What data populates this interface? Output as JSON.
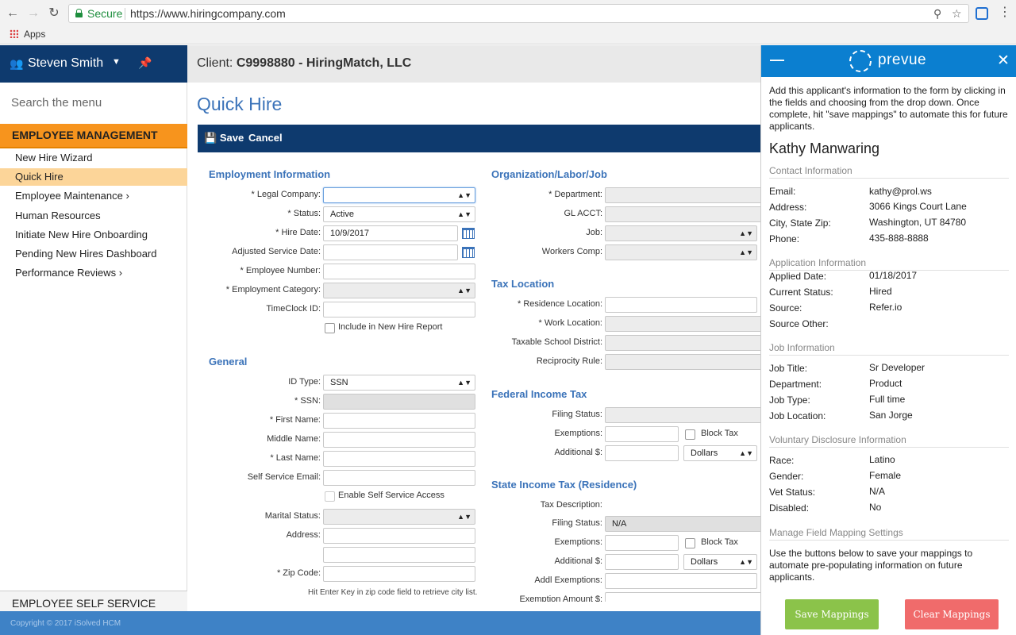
{
  "browser": {
    "secure_label": "Secure",
    "url": "https://www.hiringcompany.com",
    "apps_label": "Apps"
  },
  "sidebar": {
    "user_name": "Steven Smith",
    "search_placeholder": "Search the menu",
    "section": "EMPLOYEE MANAGEMENT",
    "items": [
      {
        "label": "New Hire Wizard"
      },
      {
        "label": "Quick Hire"
      },
      {
        "label": "Employee Maintenance  ›"
      },
      {
        "label": "Human Resources"
      },
      {
        "label": "Initiate New Hire Onboarding"
      },
      {
        "label": "Pending New Hires Dashboard"
      },
      {
        "label": "Performance Reviews  ›"
      }
    ],
    "self_service": "EMPLOYEE SELF SERVICE",
    "copyright": "Copyright © 2017 iSolved HCM"
  },
  "header": {
    "client_prefix": "Client:",
    "client_name": "C9998880 - HiringMatch, LLC"
  },
  "page": {
    "title": "Quick Hire",
    "save": "Save",
    "cancel": "Cancel"
  },
  "employment": {
    "title": "Employment Information",
    "legal_company": "* Legal Company:",
    "status": "* Status:",
    "status_value": "Active",
    "hire_date": "* Hire Date:",
    "hire_date_value": "10/9/2017",
    "adjusted_service_date": "Adjusted Service Date:",
    "employee_number": "* Employee Number:",
    "employment_category": "* Employment Category:",
    "timeclock_id": "TimeClock ID:",
    "include_report": "Include in New Hire Report"
  },
  "general": {
    "title": "General",
    "id_type": "ID Type:",
    "id_type_value": "SSN",
    "ssn": "* SSN:",
    "first_name": "* First Name:",
    "middle_name": "Middle Name:",
    "last_name": "* Last Name:",
    "self_service_email": "Self Service Email:",
    "enable_self_service": "Enable Self Service Access",
    "marital_status": "Marital Status:",
    "address": "Address:",
    "zip_code": "* Zip Code:",
    "zip_hint": "Hit Enter Key in zip code field to retrieve city list."
  },
  "org": {
    "title": "Organization/Labor/Job",
    "department": "* Department:",
    "gl_acct": "GL ACCT:",
    "job": "Job:",
    "workers_comp": "Workers Comp:"
  },
  "tax_location": {
    "title": "Tax Location",
    "residence_location": "* Residence Location:",
    "work_location": "* Work Location:",
    "taxable_school_district": "Taxable School District:",
    "reciprocity_rule": "Reciprocity Rule:"
  },
  "federal": {
    "title": "Federal Income Tax",
    "filing_status": "Filing Status:",
    "exemptions": "Exemptions:",
    "block_tax": "Block Tax",
    "additional": "Additional $:",
    "dollars": "Dollars"
  },
  "state": {
    "title": "State Income Tax (Residence)",
    "tax_description": "Tax Description:",
    "filing_status": "Filing Status:",
    "filing_status_value": "N/A",
    "exemptions": "Exemptions:",
    "block_tax": "Block Tax",
    "additional": "Additional $:",
    "dollars": "Dollars",
    "addl_exemptions": "Addl Exemptions:",
    "exemption_amount": "Exemption Amount $:"
  },
  "prevue": {
    "brand": "prevue",
    "intro": "Add this applicant's information to the form by clicking in the fields and choosing from the drop down. Once complete, hit \"save mappings\" to automate this for future applicants.",
    "name": "Kathy Manwaring",
    "contact_title": "Contact Information",
    "contact": [
      {
        "k": "Email:",
        "v": "kathy@prol.ws"
      },
      {
        "k": "Address:",
        "v": "3066 Kings Court Lane"
      },
      {
        "k": "City, State Zip:",
        "v": "Washington, UT 84780"
      },
      {
        "k": "Phone:",
        "v": "435-888-8888"
      }
    ],
    "application_title": "Application Information",
    "application": [
      {
        "k": "Applied Date:",
        "v": "01/18/2017"
      },
      {
        "k": "Current Status:",
        "v": "Hired"
      },
      {
        "k": "Source:",
        "v": "Refer.io"
      },
      {
        "k": "Source Other:",
        "v": ""
      }
    ],
    "job_title": "Job Information",
    "job": [
      {
        "k": "Job Title:",
        "v": "Sr Developer"
      },
      {
        "k": "Department:",
        "v": "Product"
      },
      {
        "k": "Job Type:",
        "v": "Full time"
      },
      {
        "k": "Job Location:",
        "v": "San Jorge"
      }
    ],
    "voluntary_title": "Voluntary Disclosure Information",
    "voluntary": [
      {
        "k": "Race:",
        "v": "Latino"
      },
      {
        "k": "Gender:",
        "v": "Female"
      },
      {
        "k": "Vet Status:",
        "v": "N/A"
      },
      {
        "k": "Disabled:",
        "v": "No"
      }
    ],
    "manage_title": "Manage Field Mapping Settings",
    "manage_text": "Use the buttons below to save your mappings to automate pre-populating information on future applicants.",
    "save_mappings": "Save Mappings",
    "clear_mappings": "Clear Mappings"
  }
}
